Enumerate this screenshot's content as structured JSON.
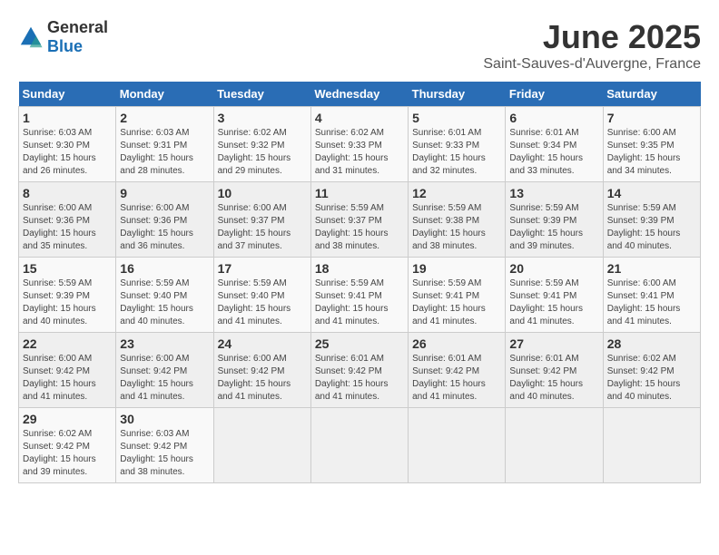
{
  "header": {
    "logo_general": "General",
    "logo_blue": "Blue",
    "title": "June 2025",
    "subtitle": "Saint-Sauves-d'Auvergne, France"
  },
  "calendar": {
    "weekdays": [
      "Sunday",
      "Monday",
      "Tuesday",
      "Wednesday",
      "Thursday",
      "Friday",
      "Saturday"
    ],
    "weeks": [
      [
        {
          "day": "",
          "info": ""
        },
        {
          "day": "2",
          "info": "Sunrise: 6:03 AM\nSunset: 9:31 PM\nDaylight: 15 hours and 28 minutes."
        },
        {
          "day": "3",
          "info": "Sunrise: 6:02 AM\nSunset: 9:32 PM\nDaylight: 15 hours and 29 minutes."
        },
        {
          "day": "4",
          "info": "Sunrise: 6:02 AM\nSunset: 9:33 PM\nDaylight: 15 hours and 31 minutes."
        },
        {
          "day": "5",
          "info": "Sunrise: 6:01 AM\nSunset: 9:33 PM\nDaylight: 15 hours and 32 minutes."
        },
        {
          "day": "6",
          "info": "Sunrise: 6:01 AM\nSunset: 9:34 PM\nDaylight: 15 hours and 33 minutes."
        },
        {
          "day": "7",
          "info": "Sunrise: 6:00 AM\nSunset: 9:35 PM\nDaylight: 15 hours and 34 minutes."
        }
      ],
      [
        {
          "day": "8",
          "info": "Sunrise: 6:00 AM\nSunset: 9:36 PM\nDaylight: 15 hours and 35 minutes."
        },
        {
          "day": "9",
          "info": "Sunrise: 6:00 AM\nSunset: 9:36 PM\nDaylight: 15 hours and 36 minutes."
        },
        {
          "day": "10",
          "info": "Sunrise: 6:00 AM\nSunset: 9:37 PM\nDaylight: 15 hours and 37 minutes."
        },
        {
          "day": "11",
          "info": "Sunrise: 5:59 AM\nSunset: 9:37 PM\nDaylight: 15 hours and 38 minutes."
        },
        {
          "day": "12",
          "info": "Sunrise: 5:59 AM\nSunset: 9:38 PM\nDaylight: 15 hours and 38 minutes."
        },
        {
          "day": "13",
          "info": "Sunrise: 5:59 AM\nSunset: 9:39 PM\nDaylight: 15 hours and 39 minutes."
        },
        {
          "day": "14",
          "info": "Sunrise: 5:59 AM\nSunset: 9:39 PM\nDaylight: 15 hours and 40 minutes."
        }
      ],
      [
        {
          "day": "15",
          "info": "Sunrise: 5:59 AM\nSunset: 9:39 PM\nDaylight: 15 hours and 40 minutes."
        },
        {
          "day": "16",
          "info": "Sunrise: 5:59 AM\nSunset: 9:40 PM\nDaylight: 15 hours and 40 minutes."
        },
        {
          "day": "17",
          "info": "Sunrise: 5:59 AM\nSunset: 9:40 PM\nDaylight: 15 hours and 41 minutes."
        },
        {
          "day": "18",
          "info": "Sunrise: 5:59 AM\nSunset: 9:41 PM\nDaylight: 15 hours and 41 minutes."
        },
        {
          "day": "19",
          "info": "Sunrise: 5:59 AM\nSunset: 9:41 PM\nDaylight: 15 hours and 41 minutes."
        },
        {
          "day": "20",
          "info": "Sunrise: 5:59 AM\nSunset: 9:41 PM\nDaylight: 15 hours and 41 minutes."
        },
        {
          "day": "21",
          "info": "Sunrise: 6:00 AM\nSunset: 9:41 PM\nDaylight: 15 hours and 41 minutes."
        }
      ],
      [
        {
          "day": "22",
          "info": "Sunrise: 6:00 AM\nSunset: 9:42 PM\nDaylight: 15 hours and 41 minutes."
        },
        {
          "day": "23",
          "info": "Sunrise: 6:00 AM\nSunset: 9:42 PM\nDaylight: 15 hours and 41 minutes."
        },
        {
          "day": "24",
          "info": "Sunrise: 6:00 AM\nSunset: 9:42 PM\nDaylight: 15 hours and 41 minutes."
        },
        {
          "day": "25",
          "info": "Sunrise: 6:01 AM\nSunset: 9:42 PM\nDaylight: 15 hours and 41 minutes."
        },
        {
          "day": "26",
          "info": "Sunrise: 6:01 AM\nSunset: 9:42 PM\nDaylight: 15 hours and 41 minutes."
        },
        {
          "day": "27",
          "info": "Sunrise: 6:01 AM\nSunset: 9:42 PM\nDaylight: 15 hours and 40 minutes."
        },
        {
          "day": "28",
          "info": "Sunrise: 6:02 AM\nSunset: 9:42 PM\nDaylight: 15 hours and 40 minutes."
        }
      ],
      [
        {
          "day": "29",
          "info": "Sunrise: 6:02 AM\nSunset: 9:42 PM\nDaylight: 15 hours and 39 minutes."
        },
        {
          "day": "30",
          "info": "Sunrise: 6:03 AM\nSunset: 9:42 PM\nDaylight: 15 hours and 38 minutes."
        },
        {
          "day": "",
          "info": ""
        },
        {
          "day": "",
          "info": ""
        },
        {
          "day": "",
          "info": ""
        },
        {
          "day": "",
          "info": ""
        },
        {
          "day": "",
          "info": ""
        }
      ]
    ],
    "first_day": {
      "day": "1",
      "info": "Sunrise: 6:03 AM\nSunset: 9:30 PM\nDaylight: 15 hours and 26 minutes."
    }
  }
}
